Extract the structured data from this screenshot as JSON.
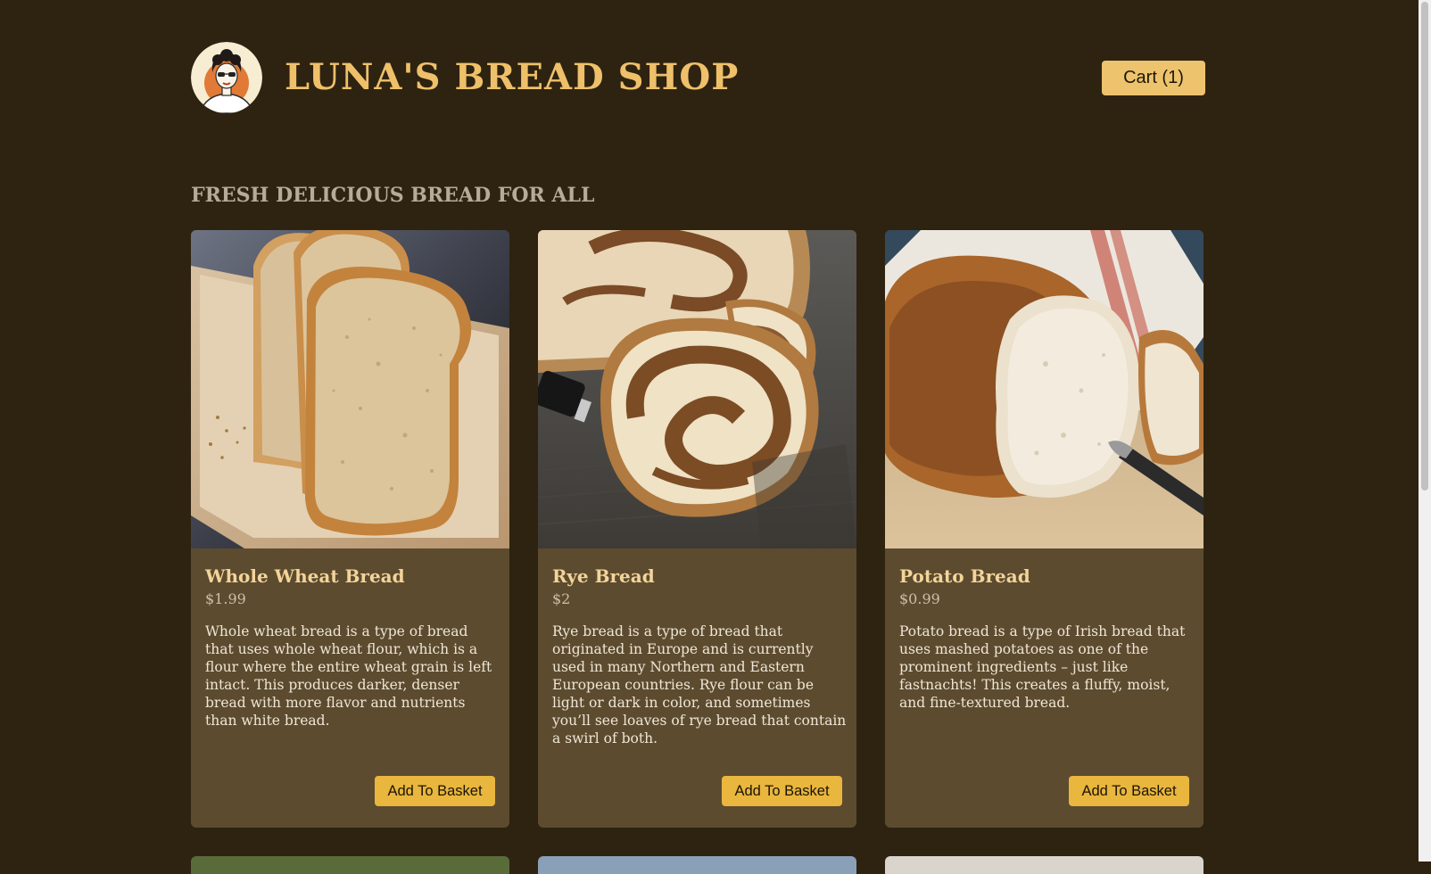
{
  "header": {
    "title": "LUNA'S BREAD SHOP",
    "cart_label": "Cart (1)",
    "logo_icon": "baker-woman-portrait-icon"
  },
  "section_heading": "FRESH DELICIOUS BREAD FOR ALL",
  "products": [
    {
      "name": "Whole Wheat Bread",
      "price": "$1.99",
      "description": "Whole wheat bread is a type of bread that uses whole wheat flour, which is a flour where the entire wheat grain is left intact. This produces darker, denser bread with more flavor and nutrients than white bread.",
      "button_label": "Add To Basket"
    },
    {
      "name": "Rye Bread",
      "price": "$2",
      "description": "Rye bread is a type of bread that originated in Europe and is currently used in many Northern and Eastern European countries. Rye flour can be light or dark in color, and sometimes you’ll see loaves of rye bread that contain a swirl of both.",
      "button_label": "Add To Basket"
    },
    {
      "name": "Potato Bread",
      "price": "$0.99",
      "description": "Potato bread is a type of Irish bread that uses mashed potatoes as one of the prominent ingredients – just like fastnachts! This creates a fluffy, moist, and fine-textured bread.",
      "button_label": "Add To Basket"
    }
  ],
  "colors": {
    "page_background": "#2e2310",
    "card_background": "#5c4b2f",
    "title_gold": "#efc06a",
    "button_gold": "#e9b63e"
  }
}
